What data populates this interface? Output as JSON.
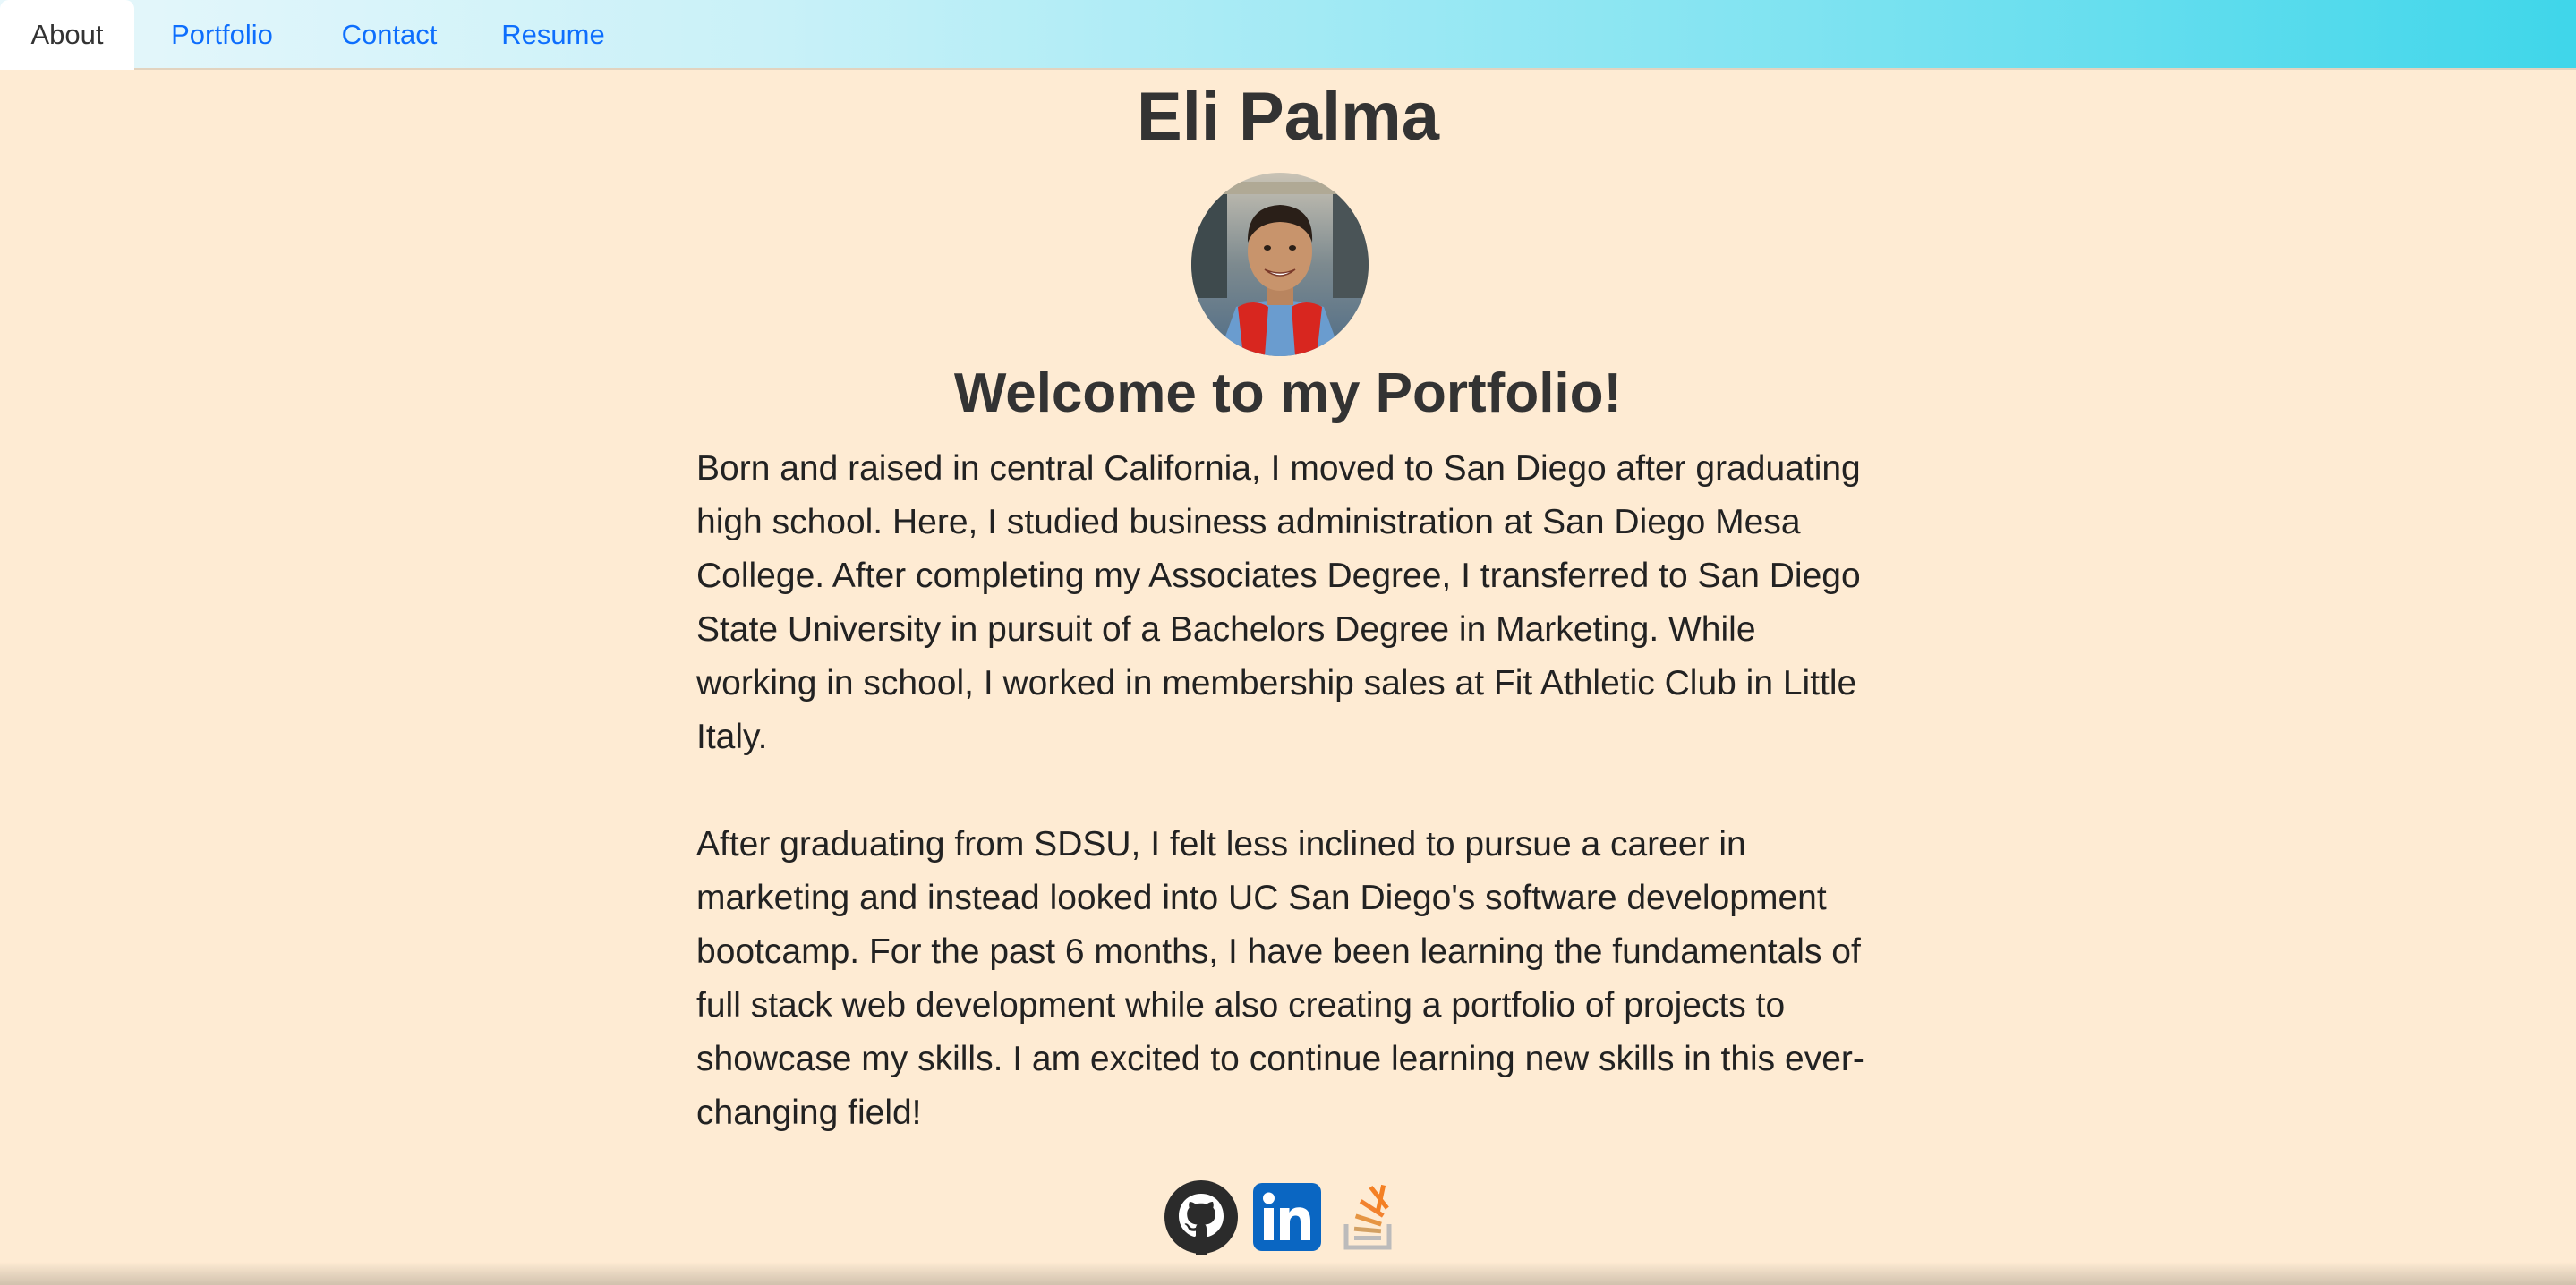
{
  "nav": {
    "tabs": [
      {
        "label": "About",
        "active": true
      },
      {
        "label": "Portfolio",
        "active": false
      },
      {
        "label": "Contact",
        "active": false
      },
      {
        "label": "Resume",
        "active": false
      }
    ]
  },
  "header": {
    "name": "Eli Palma",
    "avatar_icon": "profile-photo"
  },
  "main": {
    "welcome": "Welcome to my Portfolio!",
    "paragraphs": [
      "Born and raised in central California, I moved to San Diego after graduating high school. Here, I studied business administration at San Diego Mesa College. After completing my Associates Degree, I transferred to San Diego State University in pursuit of a Bachelors Degree in Marketing. While working in school, I worked in membership sales at Fit Athletic Club in Little Italy.",
      "After graduating from SDSU, I felt less inclined to pursue a career in marketing and instead looked into UC San Diego's software development bootcamp. For the past 6 months, I have been learning the fundamentals of full stack web development while also creating a portfolio of projects to showcase my skills. I am excited to continue learning new skills in this ever-changing field!"
    ]
  },
  "social": {
    "icons": [
      "github-icon",
      "linkedin-icon",
      "stackoverflow-icon"
    ]
  },
  "colors": {
    "background": "#feebd3",
    "link": "#0d6efd",
    "nav_gradient_end": "#3fd6ea"
  }
}
